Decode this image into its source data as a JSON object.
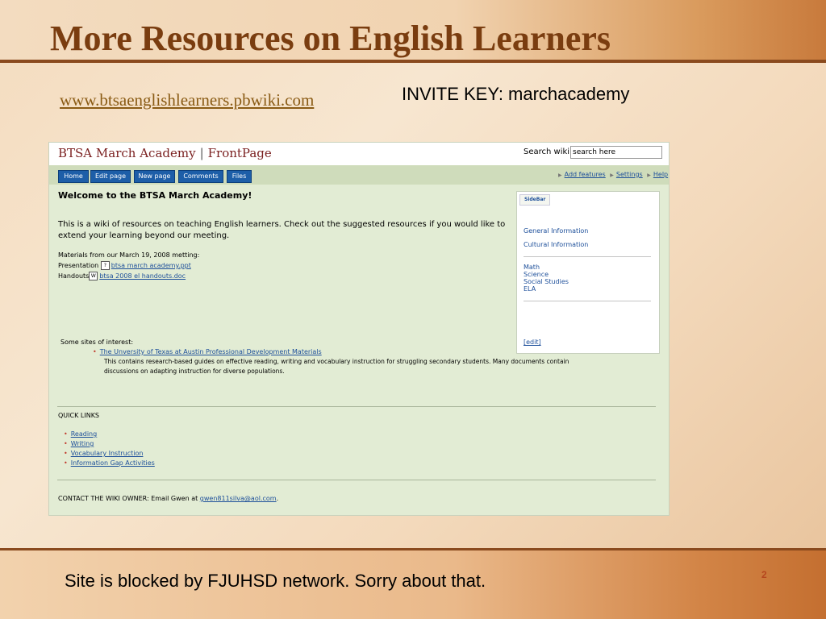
{
  "slide": {
    "title": "More Resources on English Learners",
    "url": "www.btsaenglishlearners.pbwiki.com",
    "invite": "INVITE KEY: marchacademy",
    "footer": "Site is blocked by FJUHSD network.  Sorry about that.",
    "page_number": "2"
  },
  "wiki": {
    "site_name": "BTSA March Academy",
    "separator": "|",
    "page_name": "FrontPage",
    "search_label": "Search wiki:",
    "search_value": "search here",
    "nav": [
      "Home",
      "Edit page",
      "New page",
      "Comments",
      "Files"
    ],
    "top_links": [
      "Add features",
      "Settings",
      "Help"
    ],
    "welcome": "Welcome to the BTSA March Academy!",
    "intro": "This is a wiki of resources on teaching English learners. Check out the suggested resources if you would like to extend your learning beyond our meeting.",
    "materials_heading": "Materials from our March 19, 2008 metting:",
    "presentation_label": "Presentation",
    "presentation_file": "btsa march academy.ppt",
    "handouts_label": "Handouts",
    "handouts_file": "btsa 2008 el handouts.doc",
    "sites_heading": "Some sites of interest:",
    "site_link": "The Unversity of Texas at Austin Professional Development Materials",
    "site_desc": "This contains research-based guides on effective reading, writing and vocabulary instruction for struggling secondary students.  Many documents contain discussions on adapting instruction for diverse populations.",
    "quick_links_heading": "QUICK LINKS",
    "quick_links": [
      "Reading",
      "Writing",
      "Vocabulary Instruction",
      "Information Gap Activities"
    ],
    "contact_text": "CONTACT THE WIKI OWNER: Email Gwen at",
    "contact_email": "gwen811silva@aol.com",
    "contact_end": ".",
    "sidebar": {
      "tab": "SideBar",
      "group1": [
        "General Information",
        "Cultural Information"
      ],
      "group2": [
        "Math",
        "Science",
        "Social Studies",
        "ELA"
      ],
      "edit": "[edit]"
    }
  }
}
